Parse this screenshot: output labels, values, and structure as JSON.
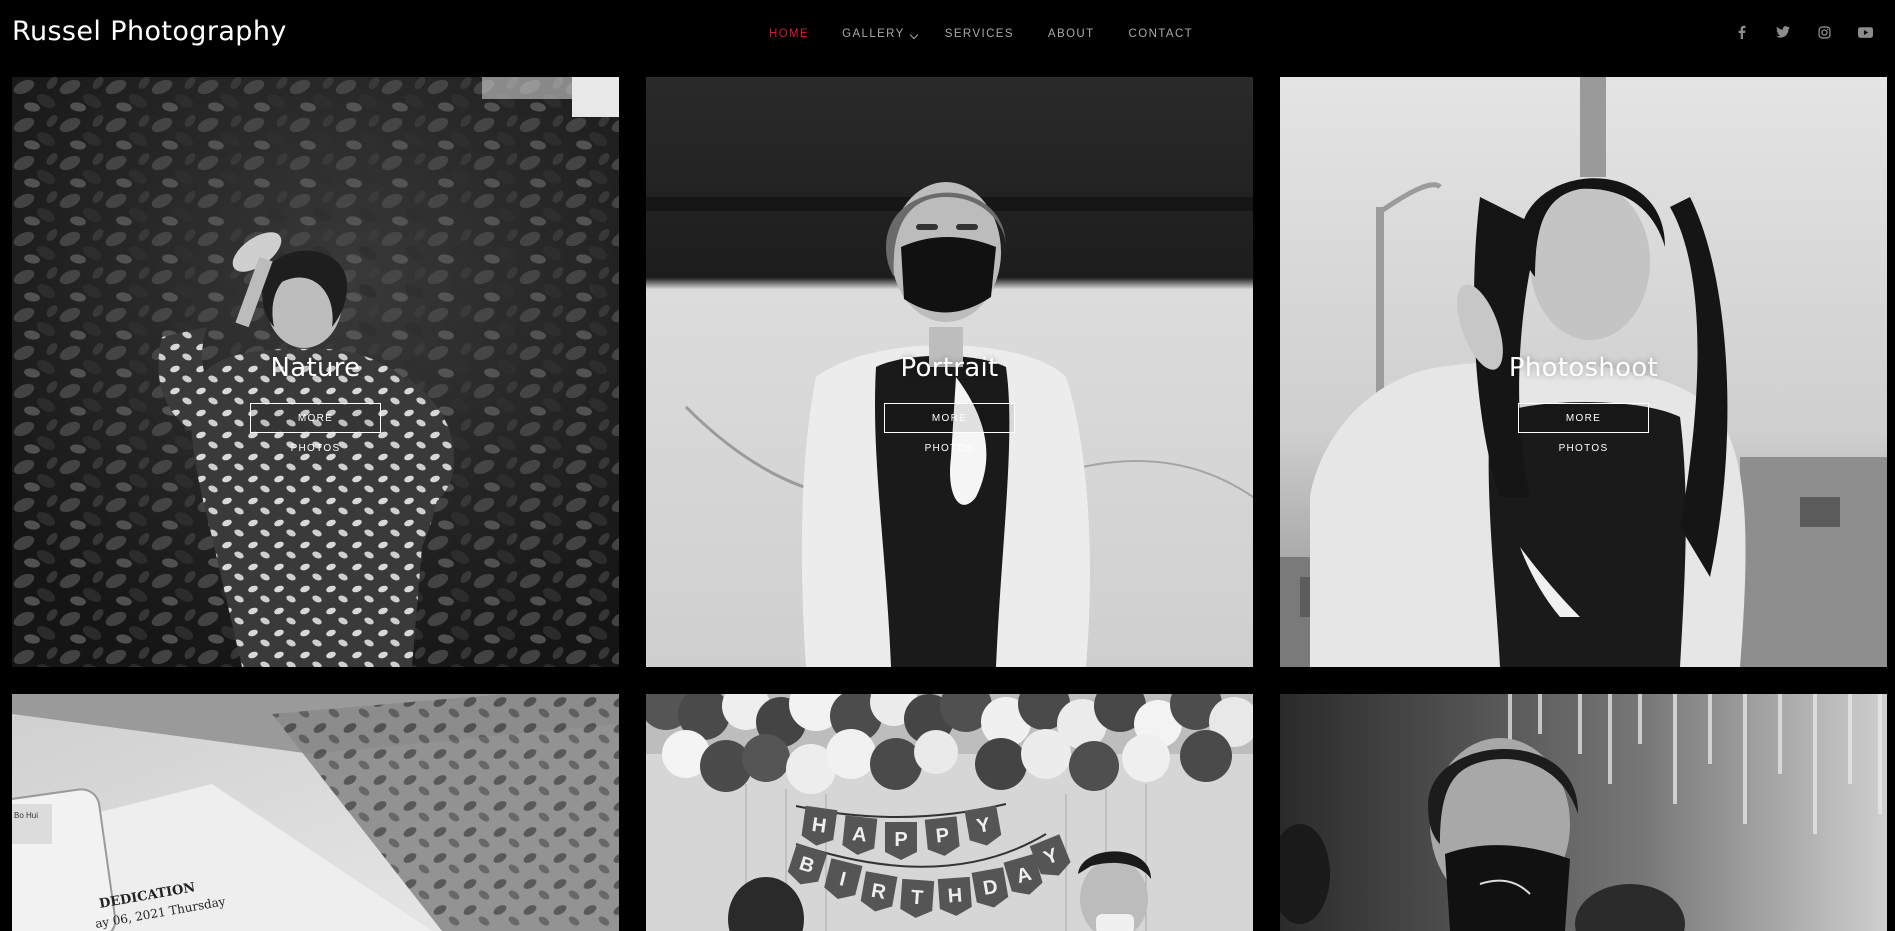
{
  "site": {
    "brand": "Russel Photography"
  },
  "nav": {
    "home": "HOME",
    "gallery": "GALLERY",
    "services": "SERVICES",
    "about": "ABOUT",
    "contact": "CONTACT",
    "active_color": "#d3193b",
    "text_color": "#a9a9a9"
  },
  "social": [
    {
      "name": "facebook-icon"
    },
    {
      "name": "twitter-icon"
    },
    {
      "name": "instagram-icon"
    },
    {
      "name": "youtube-icon"
    }
  ],
  "gallery": {
    "cards": [
      {
        "title": "Nature",
        "button": "MORE PHOTOS"
      },
      {
        "title": "Portrait",
        "button": "MORE PHOTOS"
      },
      {
        "title": "Photoshoot",
        "button": "MORE PHOTOS"
      }
    ],
    "second_row": {
      "dedication_text": "DEDICATION",
      "date_text": "ay 06, 2021 Thursday",
      "label_text": "Bo Hui",
      "banner_letters_top": [
        "H",
        "A",
        "P",
        "P",
        "Y"
      ],
      "banner_letters_bottom": [
        "B",
        "I",
        "R",
        "T",
        "H",
        "D",
        "A",
        "Y"
      ]
    }
  }
}
